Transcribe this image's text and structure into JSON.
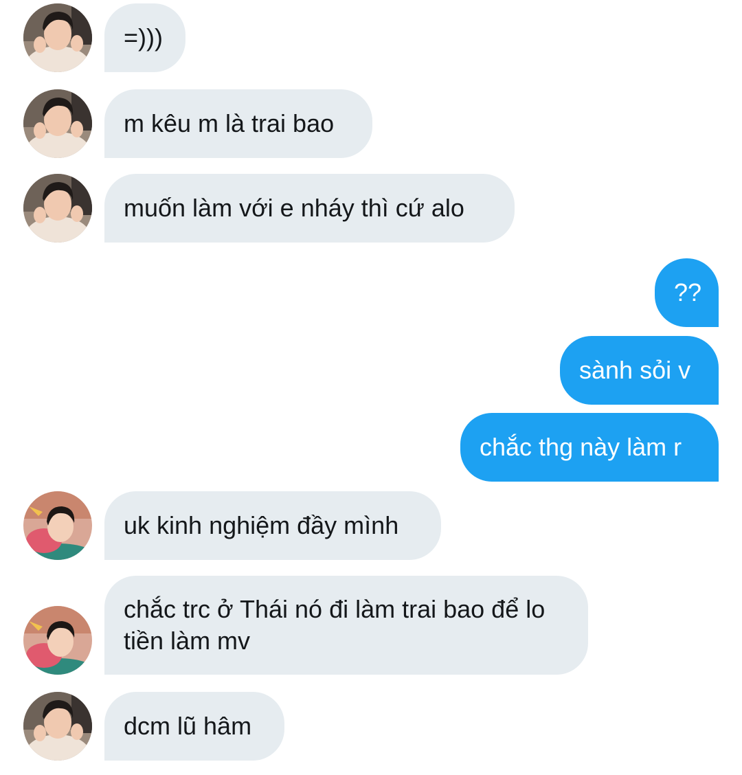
{
  "conversation": {
    "messages": [
      {
        "direction": "in",
        "sender": "user-a",
        "text": "=)))"
      },
      {
        "direction": "in",
        "sender": "user-a",
        "text": "m kêu m là trai bao"
      },
      {
        "direction": "in",
        "sender": "user-a",
        "text": "muốn làm với e nháy thì cứ alo"
      },
      {
        "direction": "out",
        "sender": "me",
        "text": "??"
      },
      {
        "direction": "out",
        "sender": "me",
        "text": "sành sỏi v"
      },
      {
        "direction": "out",
        "sender": "me",
        "text": "chắc thg này làm r"
      },
      {
        "direction": "in",
        "sender": "user-b",
        "text": "uk kinh nghiệm đầy mình"
      },
      {
        "direction": "in",
        "sender": "user-b",
        "text": "chắc trc ở Thái nó đi làm trai bao để lo tiền làm mv"
      },
      {
        "direction": "in",
        "sender": "user-a",
        "text": "dcm lũ hâm"
      }
    ]
  },
  "colors": {
    "incoming_bubble": "#e6ecf0",
    "outgoing_bubble": "#1da1f2",
    "incoming_text": "#14171a",
    "outgoing_text": "#ffffff"
  }
}
